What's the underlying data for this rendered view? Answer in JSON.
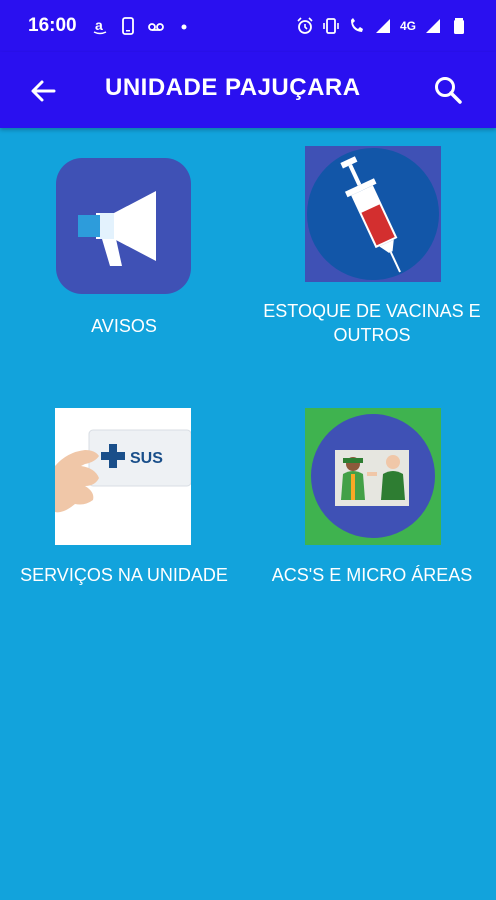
{
  "status_bar": {
    "time": "16:00",
    "network_label": "4G",
    "icons_left": [
      "amazon-icon",
      "phone-icon",
      "voicemail-icon",
      "dot-icon"
    ],
    "icons_right": [
      "alarm-icon",
      "vibrate-icon",
      "wifi-calling-icon",
      "signal-icon",
      "signal-icon",
      "battery-icon"
    ]
  },
  "app_bar": {
    "title": "UNIDADE PAJUÇARA",
    "back_icon": "arrow-left-icon",
    "search_icon": "search-icon"
  },
  "tiles": [
    {
      "id": "avisos",
      "label": "AVISOS",
      "icon": "megaphone-icon"
    },
    {
      "id": "estoque",
      "label_line1": "ESTOQUE DE VACINAS E",
      "label_line2": "OUTROS",
      "icon": "syringe-icon"
    },
    {
      "id": "servicos",
      "label": "SERVIÇOS NA UNIDADE",
      "icon": "sus-card-image",
      "image_text": "SUS"
    },
    {
      "id": "acs",
      "label": "ACS'S E MICRO ÁREAS",
      "icon": "health-agents-image"
    }
  ],
  "colors": {
    "app_bar": "#2a10f0",
    "background": "#12a3dc",
    "tile_blue": "#3f51b5",
    "green": "#3fb34f",
    "red": "#d32f2f"
  }
}
